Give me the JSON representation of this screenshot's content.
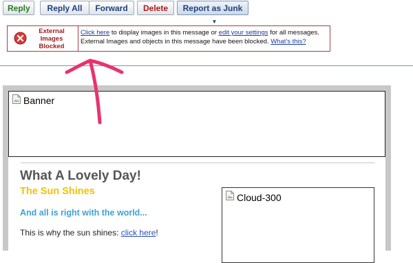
{
  "toolbar": {
    "reply": "Reply",
    "reply_all": "Reply All",
    "forward": "Forward",
    "delete": "Delete",
    "report_junk": "Report as Junk"
  },
  "blocked_notice": {
    "title": "External Images Blocked",
    "click_here": "Click here",
    "line1_mid": " to display images in this message or ",
    "edit_settings": "edit your settings",
    "line1_end": " for all messages.",
    "line2": "External Images and objects in this message have been blocked. ",
    "whats_this": "What's this?"
  },
  "email": {
    "banner_alt": "Banner",
    "heading": "What A Lovely Day!",
    "subheading": "The Sun Shines",
    "tagline": "And all is right with the world...",
    "body_text": "This is why the sun shines: ",
    "body_link": "click here",
    "body_punct": "!",
    "cloud_alt": "Cloud-300"
  },
  "colors": {
    "reply_green": "#2b7a1f",
    "link_blue": "#1a3c9e",
    "alert_red": "#9b1c1c",
    "arrow_pink": "#e8336e",
    "heading_grey": "#555555",
    "sun_yellow": "#f2c200",
    "tagline_blue": "#3da2d6"
  }
}
